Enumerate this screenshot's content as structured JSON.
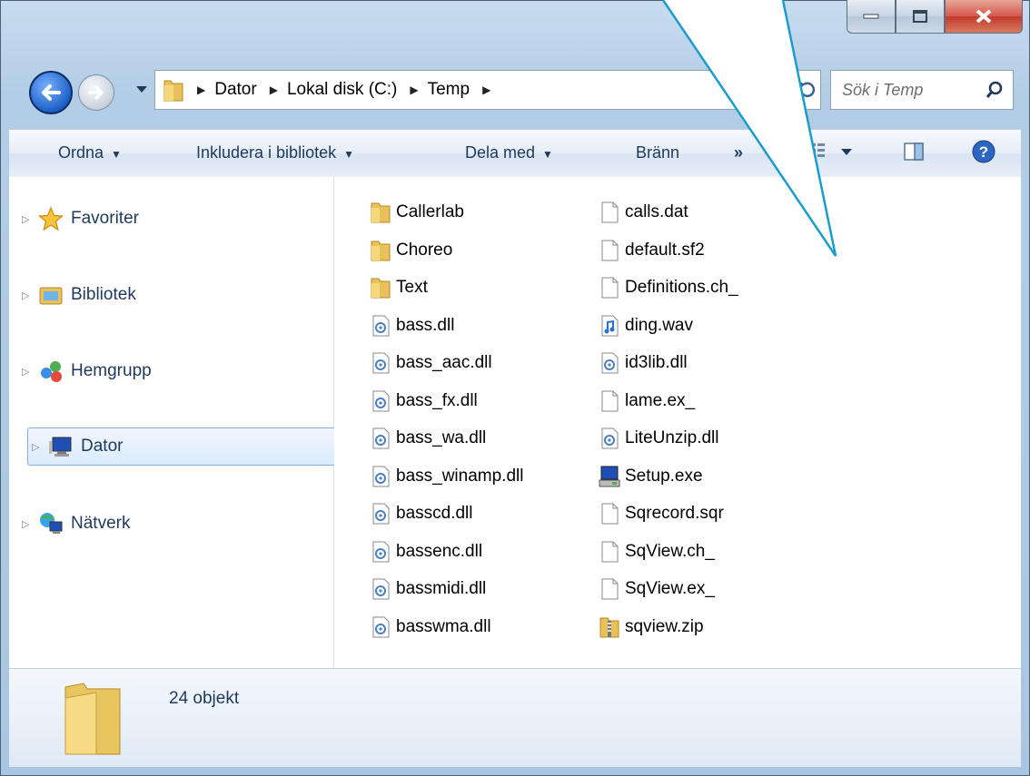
{
  "window": {
    "caption_buttons": [
      "minimize",
      "maximize",
      "close"
    ]
  },
  "address_bar": {
    "breadcrumbs": [
      "Dator",
      "Lokal disk (C:)",
      "Temp"
    ],
    "search_placeholder": "Sök i Temp"
  },
  "toolbar": {
    "organize": "Ordna",
    "include_library": "Inkludera i bibliotek",
    "share_with": "Dela med",
    "burn": "Bränn",
    "more": "»"
  },
  "nav_pane": {
    "items": [
      {
        "label": "Favoriter",
        "icon": "star-icon"
      },
      {
        "label": "Bibliotek",
        "icon": "library-icon"
      },
      {
        "label": "Hemgrupp",
        "icon": "homegroup-icon"
      },
      {
        "label": "Dator",
        "icon": "computer-icon",
        "selected": true
      },
      {
        "label": "Nätverk",
        "icon": "network-icon"
      }
    ]
  },
  "files": {
    "column1": [
      {
        "name": "Callerlab",
        "type": "folder"
      },
      {
        "name": "Choreo",
        "type": "folder"
      },
      {
        "name": "Text",
        "type": "folder"
      },
      {
        "name": "bass.dll",
        "type": "dll"
      },
      {
        "name": "bass_aac.dll",
        "type": "dll"
      },
      {
        "name": "bass_fx.dll",
        "type": "dll"
      },
      {
        "name": "bass_wa.dll",
        "type": "dll"
      },
      {
        "name": "bass_winamp.dll",
        "type": "dll"
      },
      {
        "name": "basscd.dll",
        "type": "dll"
      },
      {
        "name": "bassenc.dll",
        "type": "dll"
      },
      {
        "name": "bassmidi.dll",
        "type": "dll"
      },
      {
        "name": "basswma.dll",
        "type": "dll"
      }
    ],
    "column2": [
      {
        "name": "calls.dat",
        "type": "file"
      },
      {
        "name": "default.sf2",
        "type": "file"
      },
      {
        "name": "Definitions.ch_",
        "type": "file"
      },
      {
        "name": "ding.wav",
        "type": "audio"
      },
      {
        "name": "id3lib.dll",
        "type": "dll"
      },
      {
        "name": "lame.ex_",
        "type": "file"
      },
      {
        "name": "LiteUnzip.dll",
        "type": "dll"
      },
      {
        "name": "Setup.exe",
        "type": "setup"
      },
      {
        "name": "Sqrecord.sqr",
        "type": "file"
      },
      {
        "name": "SqView.ch_",
        "type": "file"
      },
      {
        "name": "SqView.ex_",
        "type": "file"
      },
      {
        "name": "sqview.zip",
        "type": "zip"
      }
    ]
  },
  "status_bar": {
    "count": "24 objekt"
  }
}
